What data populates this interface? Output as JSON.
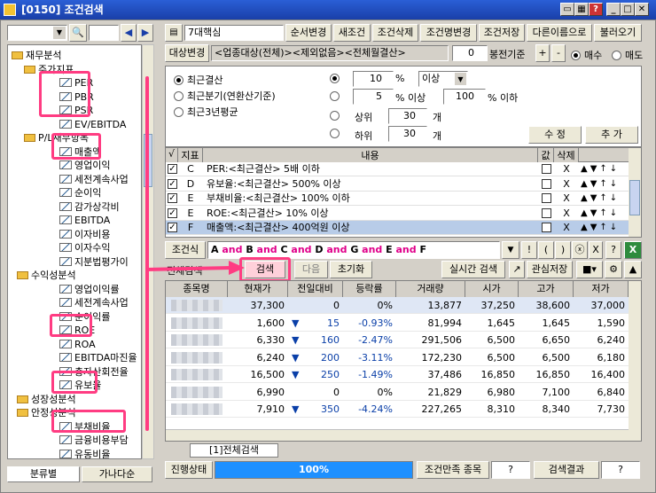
{
  "window": {
    "title": "[0150] 조건검색"
  },
  "left": {
    "tree": [
      {
        "label": "재무분석",
        "type": "folder"
      },
      {
        "label": "주가지표",
        "type": "folder"
      },
      {
        "label": "PER",
        "type": "leaf"
      },
      {
        "label": "PBR",
        "type": "leaf"
      },
      {
        "label": "PSR",
        "type": "leaf"
      },
      {
        "label": "EV/EBITDA",
        "type": "leaf"
      },
      {
        "label": "P/L재무항목",
        "type": "folder"
      },
      {
        "label": "매출액",
        "type": "leaf"
      },
      {
        "label": "영업이익",
        "type": "leaf"
      },
      {
        "label": "세전계속사업",
        "type": "leaf"
      },
      {
        "label": "순이익",
        "type": "leaf"
      },
      {
        "label": "감가상각비",
        "type": "leaf"
      },
      {
        "label": "EBITDA",
        "type": "leaf"
      },
      {
        "label": "이자비용",
        "type": "leaf"
      },
      {
        "label": "이자수익",
        "type": "leaf"
      },
      {
        "label": "지분법평가이",
        "type": "leaf"
      },
      {
        "label": "수익성분석",
        "type": "folder"
      },
      {
        "label": "영업이익률",
        "type": "leaf"
      },
      {
        "label": "세전계속사업",
        "type": "leaf"
      },
      {
        "label": "순이익률",
        "type": "leaf"
      },
      {
        "label": "ROE",
        "type": "leaf"
      },
      {
        "label": "ROA",
        "type": "leaf"
      },
      {
        "label": "EBITDA마진율",
        "type": "leaf"
      },
      {
        "label": "총자산회전율",
        "type": "leaf"
      },
      {
        "label": "유보율",
        "type": "leaf"
      },
      {
        "label": "성장성분석",
        "type": "folder"
      },
      {
        "label": "안정성분석",
        "type": "folder"
      },
      {
        "label": "부채비율",
        "type": "leaf"
      },
      {
        "label": "금융비용부담",
        "type": "leaf"
      },
      {
        "label": "유동비율",
        "type": "leaf"
      }
    ],
    "tab_category": "분류별",
    "tab_alpha": "가나다순"
  },
  "toolbar": {
    "name_value": "7대핵심",
    "order_change": "순서변경",
    "new_condition": "새조건",
    "delete_condition": "조건삭제",
    "rename_condition": "조건명변경",
    "save_condition": "조건저장",
    "save_as": "다른이름으로",
    "load": "불러오기"
  },
  "target": {
    "label": "대상변경",
    "text": "<업종대상(전체)><제외없음><전체월결산>",
    "spin_value": "0",
    "bong_label": "봉전기준",
    "plus": "+",
    "minus": "-",
    "buy": "매수",
    "sell": "매도"
  },
  "options": {
    "period_recent": "최근결산",
    "period_quarter": "최근분기(연환산기준)",
    "period_3y": "최근3년평균",
    "val1": "10",
    "pct": "%",
    "cmp1": "이상",
    "val2": "5",
    "pct_above": "% 이상",
    "val3": "100",
    "pct_below": "% 이하",
    "top": "상위",
    "top_val": "30",
    "bottom": "하위",
    "bottom_val": "30",
    "unit": "개",
    "edit": "수 정",
    "add": "추 가"
  },
  "conditions": {
    "headers": [
      "√",
      "지표",
      "내용",
      "값",
      "삭제"
    ],
    "rows": [
      {
        "id": "C",
        "text": "PER:<최근결산> 5배 이하",
        "del": "X"
      },
      {
        "id": "D",
        "text": "유보율:<최근결산> 500% 이상",
        "del": "X"
      },
      {
        "id": "E",
        "text": "부채비율:<최근결산> 100% 이하",
        "del": "X"
      },
      {
        "id": "E",
        "text": "ROE:<최근결산> 10% 이상",
        "del": "X"
      },
      {
        "id": "F",
        "text": "매출액:<최근결산> 400억원 이상",
        "del": "X"
      }
    ]
  },
  "formula": {
    "label": "조건식",
    "expr": "A and B and C and D and G and E and F",
    "btn_not": "!",
    "btn_lp": "(",
    "btn_rp": ")",
    "btn_x": "ⓧ",
    "btn_help": "?"
  },
  "search": {
    "all_label": "전체검색",
    "search_btn": "검색",
    "next_btn": "다음",
    "reset_btn": "초기화",
    "realtime": "실시간 검색",
    "save_watch": "관심저장"
  },
  "results": {
    "headers": [
      "종목명",
      "현재가",
      "전일대비",
      "등락률",
      "거래량",
      "시가",
      "고가",
      "저가"
    ],
    "rows": [
      {
        "price": "37,300",
        "chg": "0",
        "down": false,
        "rate": "0%",
        "vol": "13,877",
        "open": "37,250",
        "high": "38,600",
        "low": "37,000"
      },
      {
        "price": "1,600",
        "chg": "15",
        "down": true,
        "rate": "-0.93%",
        "vol": "81,994",
        "open": "1,645",
        "high": "1,645",
        "low": "1,590"
      },
      {
        "price": "6,330",
        "chg": "160",
        "down": true,
        "rate": "-2.47%",
        "vol": "291,506",
        "open": "6,500",
        "high": "6,650",
        "low": "6,240"
      },
      {
        "price": "6,240",
        "chg": "200",
        "down": true,
        "rate": "-3.11%",
        "vol": "172,230",
        "open": "6,500",
        "high": "6,500",
        "low": "6,180"
      },
      {
        "price": "16,500",
        "chg": "250",
        "down": true,
        "rate": "-1.49%",
        "vol": "37,486",
        "open": "16,850",
        "high": "16,850",
        "low": "16,400"
      },
      {
        "price": "6,990",
        "chg": "0",
        "down": false,
        "rate": "0%",
        "vol": "21,829",
        "open": "6,980",
        "high": "7,100",
        "low": "6,840"
      },
      {
        "price": "7,910",
        "chg": "350",
        "down": true,
        "rate": "-4.24%",
        "vol": "227,265",
        "open": "8,310",
        "high": "8,340",
        "low": "7,730"
      }
    ]
  },
  "status": {
    "tab": "[1]전체검색",
    "progress_label": "진행상태",
    "progress": "100%",
    "match_label": "조건만족 종목",
    "match_val": "?",
    "result_label": "검색결과",
    "result_val": "?"
  }
}
